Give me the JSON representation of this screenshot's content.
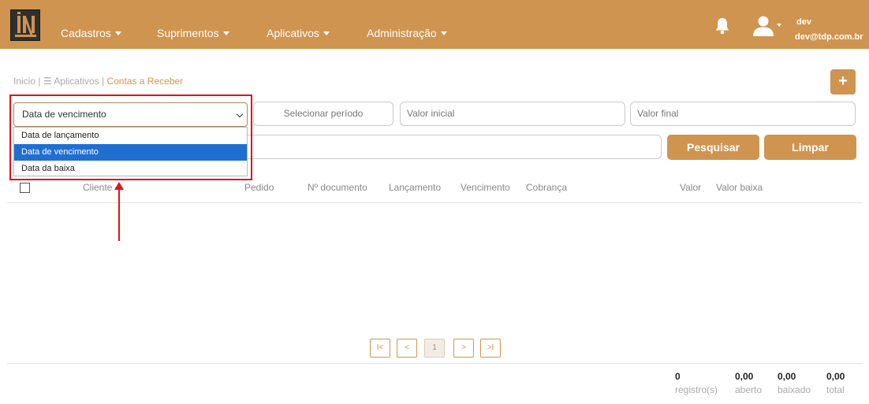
{
  "header": {
    "nav": [
      {
        "label": "Cadastros"
      },
      {
        "label": "Suprimentos"
      },
      {
        "label": "Aplicativos"
      },
      {
        "label": "Administração"
      }
    ],
    "user": {
      "name": "dev",
      "email": "dev@tdp.com.br"
    }
  },
  "breadcrumb": {
    "home": "Inicio",
    "sep": "|",
    "apps": "Aplicativos",
    "current": "Contas a Receber"
  },
  "add_button": "+",
  "filters": {
    "date_type_selected": "Data de vencimento",
    "date_type_options": [
      "Data de lançamento",
      "Data de vencimento",
      "Data da baixa"
    ],
    "period_placeholder": "Selecionar período",
    "valor_inicial_placeholder": "Valor inicial",
    "valor_final_placeholder": "Valor final",
    "search_label": "Pesquisar",
    "clear_label": "Limpar"
  },
  "table": {
    "columns": [
      "Cliente",
      "Pedido",
      "Nº documento",
      "Lançamento",
      "Vencimento",
      "Cobrança",
      "Valor",
      "Valor baixa"
    ]
  },
  "pagination": {
    "first": "I<",
    "prev": "<",
    "page": "1",
    "next": ">",
    "last": ">I"
  },
  "summary": [
    {
      "value": "0",
      "label": "registro(s)"
    },
    {
      "value": "0,00",
      "label": "aberto"
    },
    {
      "value": "0,00",
      "label": "baixado"
    },
    {
      "value": "0,00",
      "label": "total"
    }
  ],
  "colors": {
    "accent": "#cf944f",
    "highlight": "#1f6fd1",
    "annotation": "#e0121b"
  }
}
